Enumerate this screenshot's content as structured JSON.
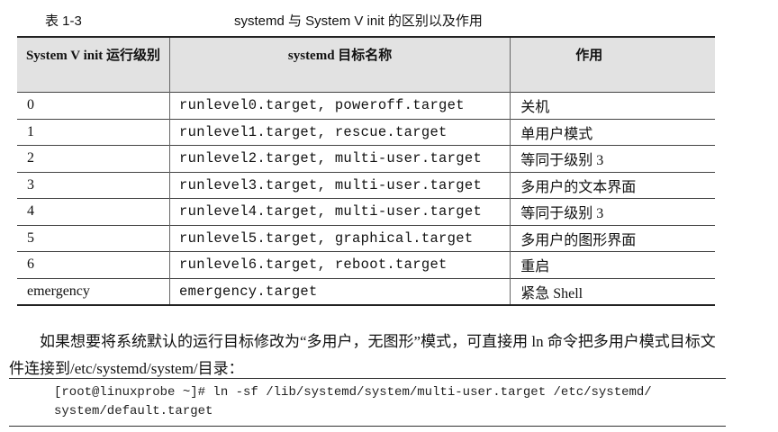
{
  "caption": {
    "number": "表 1-3",
    "title": "systemd 与 System V init 的区别以及作用"
  },
  "table": {
    "headers": [
      "System V init 运行级别",
      "systemd 目标名称",
      "作用"
    ],
    "rows": [
      [
        "0",
        "runlevel0.target, poweroff.target",
        "关机"
      ],
      [
        "1",
        "runlevel1.target, rescue.target",
        "单用户模式"
      ],
      [
        "2",
        "runlevel2.target, multi-user.target",
        "等同于级别 3"
      ],
      [
        "3",
        "runlevel3.target, multi-user.target",
        "多用户的文本界面"
      ],
      [
        "4",
        "runlevel4.target, multi-user.target",
        "等同于级别 3"
      ],
      [
        "5",
        "runlevel5.target, graphical.target",
        "多用户的图形界面"
      ],
      [
        "6",
        "runlevel6.target, reboot.target",
        "重启"
      ],
      [
        "emergency",
        "emergency.target",
        "紧急 Shell"
      ]
    ]
  },
  "paragraph": "如果想要将系统默认的运行目标修改为“多用户，无图形”模式，可直接用 ln 命令把多用户模式目标文件连接到/etc/systemd/system/目录：",
  "code": {
    "line1": "[root@linuxprobe ~]# ln -sf /lib/systemd/system/multi-user.target /etc/systemd/",
    "line2": "system/default.target"
  }
}
